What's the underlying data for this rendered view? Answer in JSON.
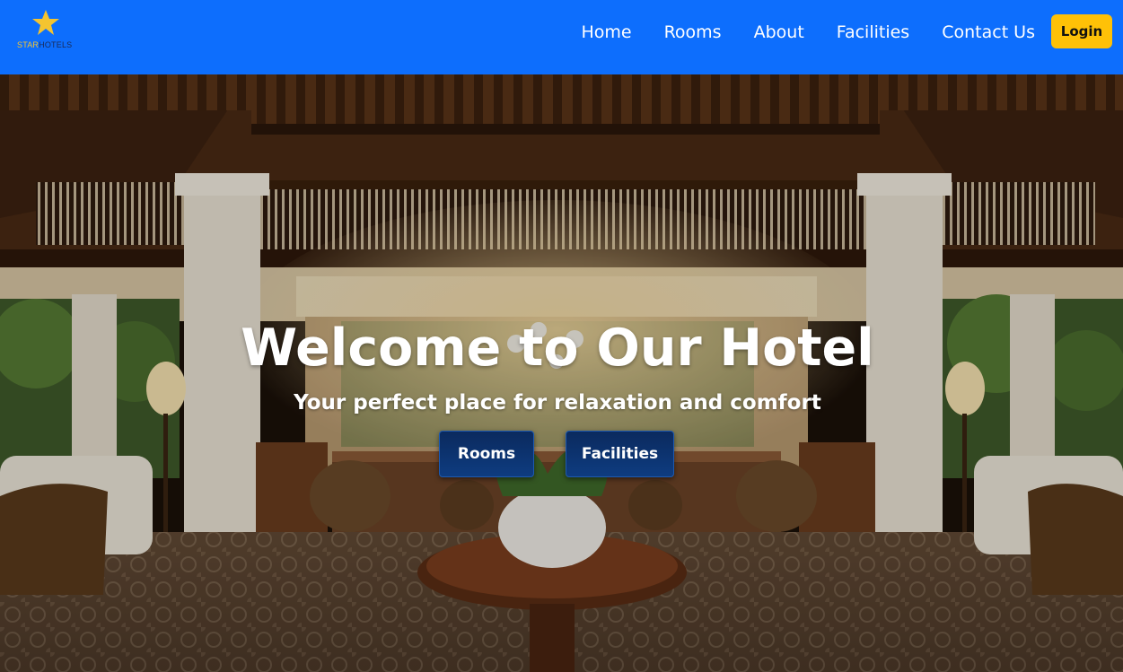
{
  "brand": {
    "logo_star": "STAR",
    "logo_hotels": "HOTELS",
    "logo_icon": "star-icon"
  },
  "nav": {
    "links": [
      "Home",
      "Rooms",
      "About",
      "Facilities",
      "Contact Us"
    ],
    "login_label": "Login"
  },
  "hero": {
    "title": "Welcome to Our Hotel",
    "subtitle": "Your perfect place for relaxation and comfort",
    "buttons": [
      "Rooms",
      "Facilities"
    ]
  },
  "colors": {
    "navbar": "#0d6efd",
    "login": "#ffc107",
    "hero_button": "#0e3c80",
    "star": "#f4c430"
  }
}
